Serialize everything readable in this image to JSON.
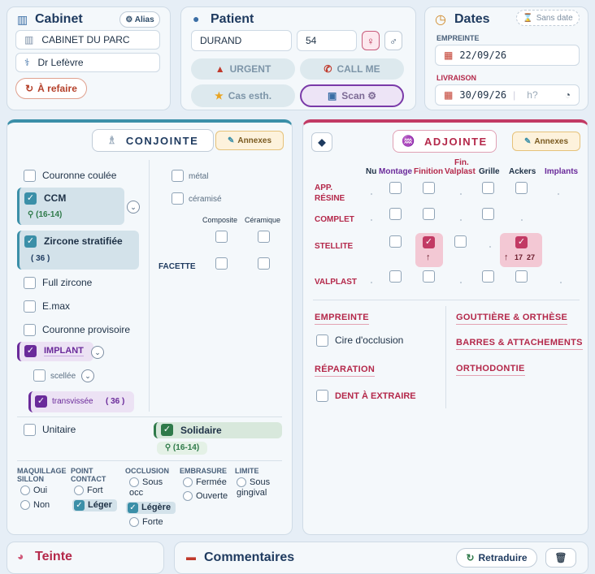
{
  "cabinet": {
    "title": "Cabinet",
    "alias_label": "⚙ Alias",
    "name": "CABINET DU PARC",
    "doctor": "Dr Lefèvre",
    "refaire_label": "À refaire"
  },
  "patient": {
    "title": "Patient",
    "name": "DURAND",
    "age": "54",
    "urgent_label": "URGENT",
    "callme_label": "CALL ME",
    "cas_label": "Cas esth.",
    "scan_label": "Scan ⚙"
  },
  "dates": {
    "title": "Dates",
    "sans_date_label": "Sans date",
    "empreinte_label": "EMPREINTE",
    "empreinte_value": "22/09/26",
    "livraison_label": "LIVRAISON",
    "livraison_value": "30/09/26",
    "heure_placeholder": "h?"
  },
  "conjointe": {
    "title": "CONJOINTE",
    "annexes_label": "Annexes",
    "items": {
      "couronne_coulee": "Couronne coulée",
      "ccm": "CCM",
      "ccm_teeth": "(16-14)",
      "zircone": "Zircone stratifiée",
      "zircone_teeth": "( 36 )",
      "full_zircone": "Full zircone",
      "emax": "E.max",
      "provisoire": "Couronne provisoire",
      "implant": "IMPLANT",
      "scellee": "scellée",
      "transvissee": "transvissée",
      "transvissee_teeth": "( 36 )"
    },
    "metal": "métal",
    "ceramise": "céramisé",
    "composite": "Composite",
    "ceramique": "Céramique",
    "facette": "FACETTE",
    "unitaire": "Unitaire",
    "solidaire": "Solidaire",
    "solidaire_teeth": "(16-14)",
    "options": {
      "maquillage": "MAQUILLAGE SILLON",
      "point_contact": "POINT CONTACT",
      "occlusion": "OCCLUSION",
      "embrasure": "EMBRASURE",
      "limite": "LIMITE",
      "oui": "Oui",
      "non": "Non",
      "fort": "Fort",
      "leger": "Léger",
      "sous_occ": "Sous occ",
      "legere": "Légère",
      "forte": "Forte",
      "fermee": "Fermée",
      "ouverte": "Ouverte",
      "sous_gingival": "Sous gingival"
    }
  },
  "adjointe": {
    "title": "ADJOINTE",
    "annexes_label": "Annexes",
    "columns": [
      "Nu",
      "Montage",
      "Finition",
      "Valplast",
      "Grille",
      "Ackers",
      "Implants"
    ],
    "fin_label": "Fin.",
    "rows": [
      "APP. RÉSINE",
      "COMPLET",
      "STELLITE",
      "VALPLAST"
    ],
    "stellite_teeth": "17  27",
    "links": {
      "empreinte": "EMPREINTE",
      "gouttiere": "GOUTTIÈRE & ORTHÈSE",
      "barres": "BARRES & ATTACHEMENTS",
      "reparation": "RÉPARATION",
      "orthodontie": "ORTHODONTIE"
    },
    "cire": "Cire d'occlusion",
    "dent_extraire": "DENT À EXTRAIRE"
  },
  "bottom": {
    "teinte": "Teinte",
    "commentaires": "Commentaires",
    "retraduire": "Retraduire"
  },
  "colors": {
    "accent": "#1e3a5f",
    "red": "#b4284a",
    "purple": "#6a2a9a",
    "teal": "#3b8fa8",
    "green": "#2f7a4a"
  }
}
